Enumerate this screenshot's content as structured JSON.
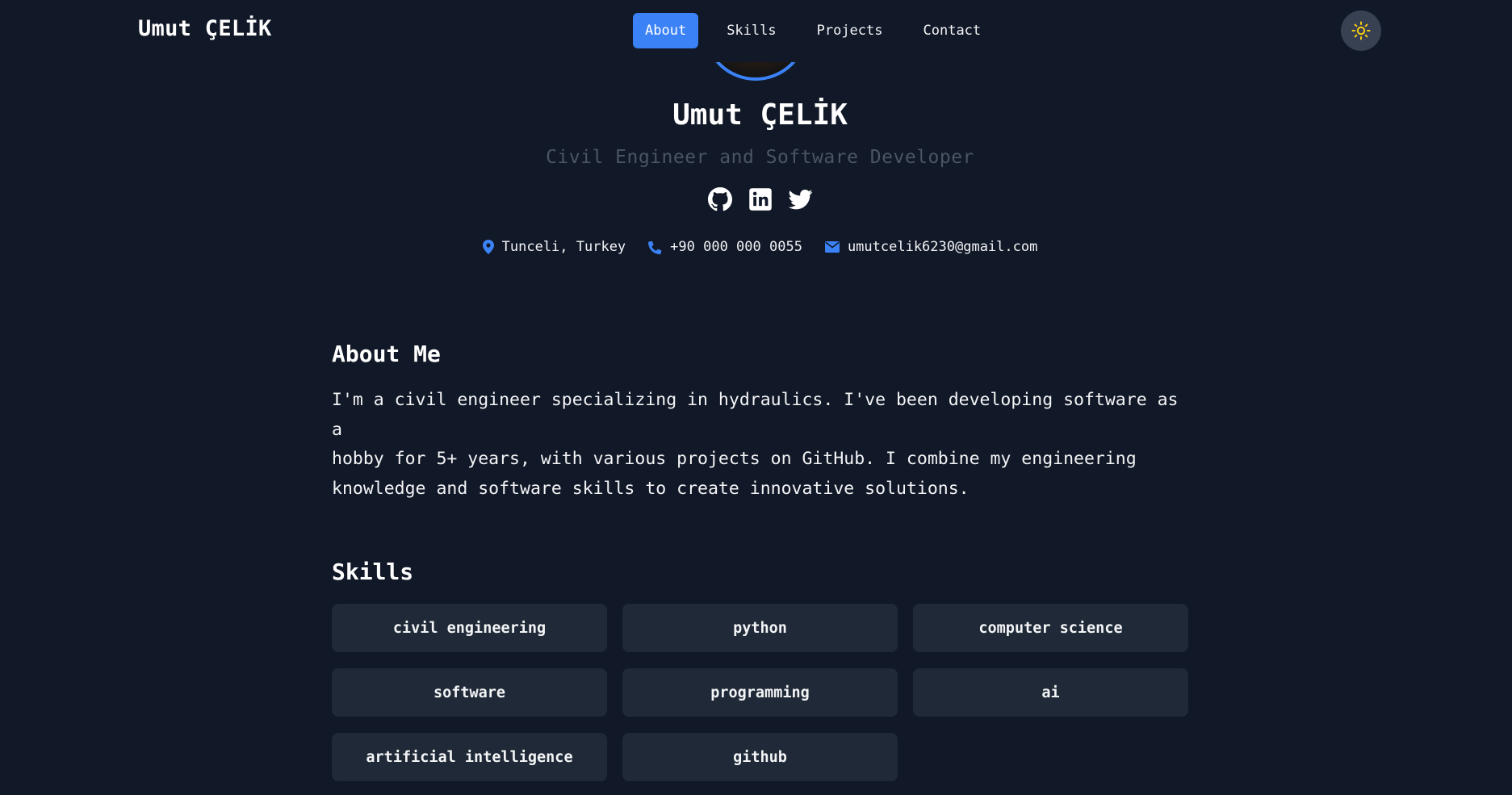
{
  "header": {
    "brand": "Umut ÇELİK",
    "nav": [
      {
        "label": "About",
        "active": true
      },
      {
        "label": "Skills",
        "active": false
      },
      {
        "label": "Projects",
        "active": false
      },
      {
        "label": "Contact",
        "active": false
      }
    ],
    "theme_toggle_icon": "sun-icon"
  },
  "hero": {
    "name": "Umut ÇELİK",
    "title": "Civil Engineer and Software Developer",
    "social": [
      "github-icon",
      "linkedin-icon",
      "twitter-icon"
    ],
    "contact": {
      "location": "Tunceli, Turkey",
      "phone": "+90 000 000 0055",
      "email": "umutcelik6230@gmail.com"
    }
  },
  "about": {
    "heading": "About Me",
    "lines": [
      "I'm a civil engineer specializing in hydraulics. I've been developing software as a",
      "hobby for 5+ years, with various projects on GitHub. I combine my engineering",
      "knowledge and software skills to create innovative solutions."
    ]
  },
  "skills": {
    "heading": "Skills",
    "items": [
      "civil engineering",
      "python",
      "computer science",
      "software",
      "programming",
      "ai",
      "artificial intelligence",
      "github"
    ]
  },
  "colors": {
    "background": "#111827",
    "card": "#1f2937",
    "accent": "#3b82f6",
    "muted": "#4b5563",
    "sun": "#facc15"
  }
}
